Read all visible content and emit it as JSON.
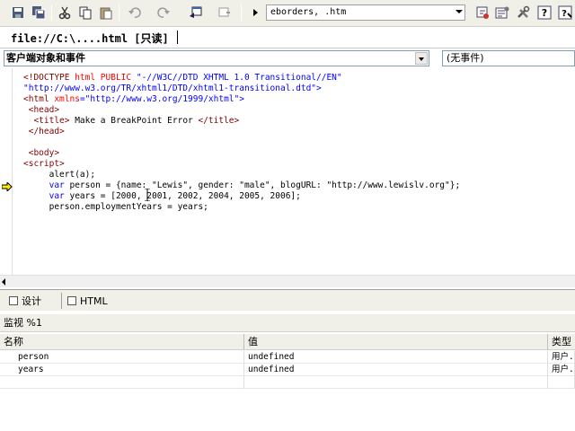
{
  "toolbar": {
    "icons": [
      "save-icon",
      "save-all-icon",
      "cut-icon",
      "copy-icon",
      "paste-icon",
      "undo-icon",
      "redo-icon",
      "open-in-icon",
      "toggle-view-icon",
      "run-icon",
      "debug-icon",
      "properties-icon",
      "tools-icon",
      "help-icon",
      "help-index-icon"
    ],
    "document_combo_value": "eborders, .htm"
  },
  "file_tab": {
    "label": "file://C:\\....html [只读]"
  },
  "object_selector": {
    "value": "客户端对象和事件"
  },
  "event_selector": {
    "value": "(无事件)"
  },
  "code_lines": [
    [
      {
        "t": "<!DOCTYPE ",
        "c": "c-maroon"
      },
      {
        "t": "html PUBLIC ",
        "c": "c-red"
      },
      {
        "t": "\"-//W3C//DTD XHTML 1.0 Transitional//EN\"",
        "c": "c-blue"
      }
    ],
    [
      {
        "t": "\"http://www.w3.org/TR/xhtml1/DTD/xhtml1-transitional.dtd\">",
        "c": "c-blue"
      }
    ],
    [
      {
        "t": "<html ",
        "c": "c-maroon"
      },
      {
        "t": "xmlns",
        "c": "c-red"
      },
      {
        "t": "=\"http://www.w3.org/1999/xhtml\">",
        "c": "c-blue"
      }
    ],
    [
      {
        "t": " <head>",
        "c": "c-maroon"
      }
    ],
    [
      {
        "t": "  <title>",
        "c": "c-maroon"
      },
      {
        "t": " Make a BreakPoint Error ",
        "c": "c-black"
      },
      {
        "t": "</title>",
        "c": "c-maroon"
      }
    ],
    [
      {
        "t": " </head>",
        "c": "c-maroon"
      }
    ],
    [
      {
        "t": "",
        "c": "c-black"
      }
    ],
    [
      {
        "t": " <body>",
        "c": "c-maroon"
      }
    ],
    [
      {
        "t": "<script>",
        "c": "c-maroon"
      }
    ],
    [
      {
        "t": "     alert(a);",
        "c": "c-black"
      }
    ],
    [
      {
        "t": "     var ",
        "c": "c-blue"
      },
      {
        "t": "person = {name: \"Lewis\", gender: \"male\", blogURL: \"http://www.lewislv.org\"};",
        "c": "c-black"
      }
    ],
    [
      {
        "t": "     var ",
        "c": "c-blue"
      },
      {
        "t": "years = [2000, 2001, 2002, 2004, 2005, 2006];",
        "c": "c-black"
      }
    ],
    [
      {
        "t": "     person.employmentYears = years;",
        "c": "c-black"
      }
    ]
  ],
  "view_tabs": {
    "design": "设计",
    "html": "HTML"
  },
  "watch": {
    "title": "监视 %1",
    "columns": [
      "名称",
      "值",
      "类型"
    ],
    "rows": [
      {
        "name": "person",
        "value": "undefined",
        "type": "用户..."
      },
      {
        "name": "years",
        "value": "undefined",
        "type": "用户..."
      }
    ]
  }
}
